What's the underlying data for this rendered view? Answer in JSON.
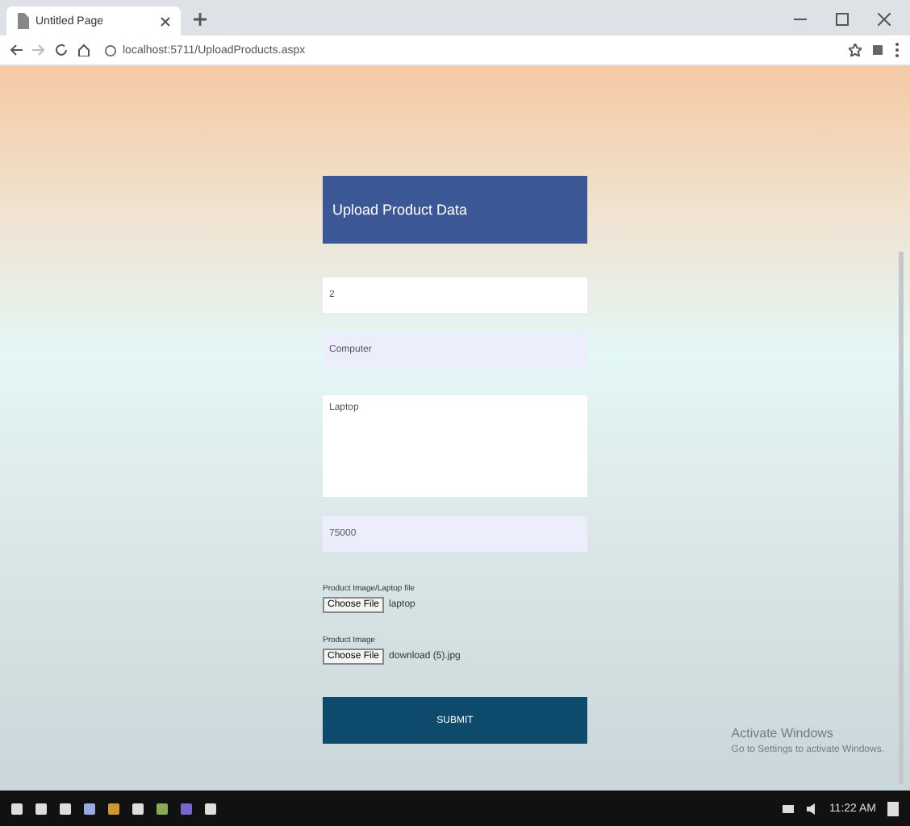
{
  "browser": {
    "tab_title": "Untitled Page",
    "url": "localhost:5711/UploadProducts.aspx"
  },
  "form": {
    "title": "Upload Product Data",
    "fields": [
      {
        "kind": "input",
        "value": "2",
        "filled": false
      },
      {
        "kind": "input",
        "value": "Computer",
        "filled": true
      },
      {
        "kind": "textarea",
        "value": "Laptop",
        "filled": false
      },
      {
        "kind": "input",
        "value": "75000",
        "filled": true
      }
    ],
    "files": [
      {
        "label": "Product Image/Laptop file",
        "button": "Choose File",
        "file_name": "laptop"
      },
      {
        "label": "Product Image",
        "button": "Choose File",
        "file_name": "download (5).jpg"
      }
    ],
    "submit": "SUBMIT"
  },
  "activation": {
    "title": "Activate Windows",
    "text": "Go to Settings to activate Windows."
  },
  "taskbar": {
    "time": "11:22 AM"
  }
}
